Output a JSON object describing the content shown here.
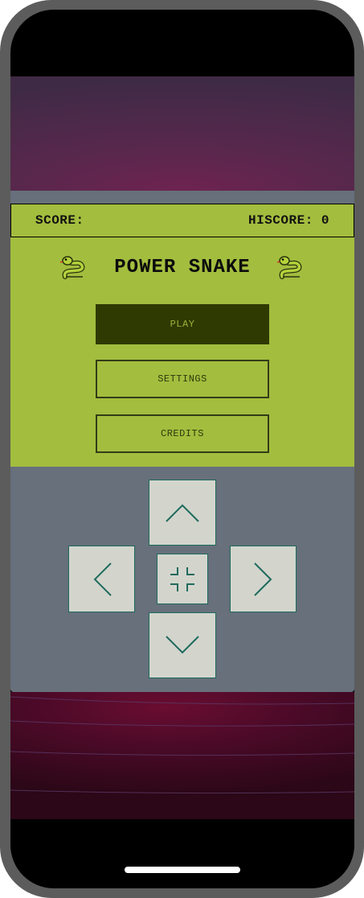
{
  "scorebar": {
    "score_label": "SCORE:",
    "hiscore_label": "HISCORE: 0"
  },
  "menu": {
    "title": "POWER SNAKE",
    "title_icon": "snake-emoji",
    "buttons": {
      "play": "PLAY",
      "settings": "SETTINGS",
      "credits": "CREDITS"
    }
  },
  "dpad": {
    "up": "chevron-up-icon",
    "down": "chevron-down-icon",
    "left": "chevron-left-icon",
    "right": "chevron-right-icon",
    "center": "minimize-icon"
  },
  "colors": {
    "accent_green": "#a3bd3e",
    "play_button": "#2f3a02",
    "panel": "#67707b",
    "key": "#d3d5cd",
    "icon": "#1e6a5c"
  }
}
